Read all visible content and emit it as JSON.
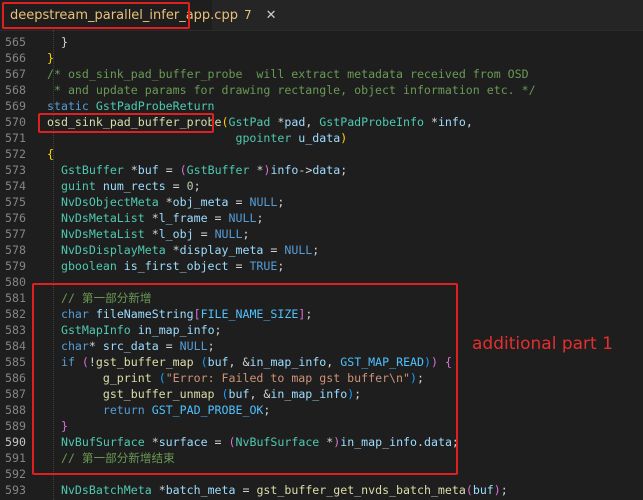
{
  "tab": {
    "filename": "deepstream_parallel_infer_app.cpp",
    "problem_count": "7",
    "close_glyph": "✕"
  },
  "annotation": "additional part 1",
  "line_numbers": [
    "565",
    "566",
    "567",
    "568",
    "569",
    "570",
    "571",
    "572",
    "573",
    "574",
    "575",
    "576",
    "577",
    "578",
    "579",
    "580",
    "581",
    "582",
    "583",
    "584",
    "585",
    "586",
    "587",
    "588",
    "589",
    "590",
    "591",
    "592",
    "593"
  ],
  "lines": [
    [
      [
        "p",
        "  }"
      ]
    ],
    [
      [
        "b1",
        "}"
      ]
    ],
    [
      [
        "c",
        "/* osd_sink_pad_buffer_probe  will extract metadata received from OSD"
      ]
    ],
    [
      [
        "c",
        " * and update params for drawing rectangle, object information etc. */"
      ]
    ],
    [
      [
        "k",
        "static "
      ],
      [
        "t",
        "GstPadProbeReturn"
      ]
    ],
    [
      [
        "f",
        "osd_sink_pad_buffer_probe"
      ],
      [
        "b1",
        "("
      ],
      [
        "t",
        "GstPad"
      ],
      [
        "p",
        " *"
      ],
      [
        "v",
        "pad"
      ],
      [
        "p",
        ", "
      ],
      [
        "t",
        "GstPadProbeInfo"
      ],
      [
        "p",
        " *"
      ],
      [
        "v",
        "info"
      ],
      [
        "p",
        ","
      ]
    ],
    [
      [
        "p",
        "                           "
      ],
      [
        "t",
        "gpointer"
      ],
      [
        "p",
        " "
      ],
      [
        "v",
        "u_data"
      ],
      [
        "b1",
        ")"
      ]
    ],
    [
      [
        "b1",
        "{"
      ]
    ],
    [
      [
        "p",
        "  "
      ],
      [
        "t",
        "GstBuffer"
      ],
      [
        "p",
        " *"
      ],
      [
        "v",
        "buf"
      ],
      [
        "p",
        " = "
      ],
      [
        "b2",
        "("
      ],
      [
        "t",
        "GstBuffer"
      ],
      [
        "p",
        " *"
      ],
      [
        "b2",
        ")"
      ],
      [
        "v",
        "info"
      ],
      [
        "p",
        "->"
      ],
      [
        "v",
        "data"
      ],
      [
        "p",
        ";"
      ]
    ],
    [
      [
        "p",
        "  "
      ],
      [
        "t",
        "guint"
      ],
      [
        "p",
        " "
      ],
      [
        "v",
        "num_rects"
      ],
      [
        "p",
        " = "
      ],
      [
        "n",
        "0"
      ],
      [
        "p",
        ";"
      ]
    ],
    [
      [
        "p",
        "  "
      ],
      [
        "t",
        "NvDsObjectMeta"
      ],
      [
        "p",
        " *"
      ],
      [
        "v",
        "obj_meta"
      ],
      [
        "p",
        " = "
      ],
      [
        "k",
        "NULL"
      ],
      [
        "p",
        ";"
      ]
    ],
    [
      [
        "p",
        "  "
      ],
      [
        "t",
        "NvDsMetaList"
      ],
      [
        "p",
        " *"
      ],
      [
        "v",
        "l_frame"
      ],
      [
        "p",
        " = "
      ],
      [
        "k",
        "NULL"
      ],
      [
        "p",
        ";"
      ]
    ],
    [
      [
        "p",
        "  "
      ],
      [
        "t",
        "NvDsMetaList"
      ],
      [
        "p",
        " *"
      ],
      [
        "v",
        "l_obj"
      ],
      [
        "p",
        " = "
      ],
      [
        "k",
        "NULL"
      ],
      [
        "p",
        ";"
      ]
    ],
    [
      [
        "p",
        "  "
      ],
      [
        "t",
        "NvDsDisplayMeta"
      ],
      [
        "p",
        " *"
      ],
      [
        "v",
        "display_meta"
      ],
      [
        "p",
        " = "
      ],
      [
        "k",
        "NULL"
      ],
      [
        "p",
        ";"
      ]
    ],
    [
      [
        "p",
        "  "
      ],
      [
        "t",
        "gboolean"
      ],
      [
        "p",
        " "
      ],
      [
        "v",
        "is_first_object"
      ],
      [
        "p",
        " = "
      ],
      [
        "k",
        "TRUE"
      ],
      [
        "p",
        ";"
      ]
    ],
    [],
    [
      [
        "p",
        "  "
      ],
      [
        "c",
        "// 第一部分新增"
      ]
    ],
    [
      [
        "p",
        "  "
      ],
      [
        "k",
        "char"
      ],
      [
        "p",
        " "
      ],
      [
        "v",
        "fileNameString"
      ],
      [
        "b2",
        "["
      ],
      [
        "m",
        "FILE_NAME_SIZE"
      ],
      [
        "b2",
        "]"
      ],
      [
        "p",
        ";"
      ]
    ],
    [
      [
        "p",
        "  "
      ],
      [
        "t",
        "GstMapInfo"
      ],
      [
        "p",
        " "
      ],
      [
        "v",
        "in_map_info"
      ],
      [
        "p",
        ";"
      ]
    ],
    [
      [
        "p",
        "  "
      ],
      [
        "k",
        "char"
      ],
      [
        "p",
        "* "
      ],
      [
        "v",
        "src_data"
      ],
      [
        "p",
        " = "
      ],
      [
        "k",
        "NULL"
      ],
      [
        "p",
        ";"
      ]
    ],
    [
      [
        "p",
        "  "
      ],
      [
        "k",
        "if"
      ],
      [
        "p",
        " "
      ],
      [
        "b2",
        "("
      ],
      [
        "p",
        "!"
      ],
      [
        "f",
        "gst_buffer_map"
      ],
      [
        "p",
        " "
      ],
      [
        "b3",
        "("
      ],
      [
        "v",
        "buf"
      ],
      [
        "p",
        ", &"
      ],
      [
        "v",
        "in_map_info"
      ],
      [
        "p",
        ", "
      ],
      [
        "m",
        "GST_MAP_READ"
      ],
      [
        "b3",
        ")"
      ],
      [
        "b2",
        ")"
      ],
      [
        "p",
        " "
      ],
      [
        "b2",
        "{"
      ]
    ],
    [
      [
        "p",
        "        "
      ],
      [
        "f",
        "g_print"
      ],
      [
        "p",
        " "
      ],
      [
        "b3",
        "("
      ],
      [
        "s",
        "\"Error: Failed to map gst buffer\\n\""
      ],
      [
        "b3",
        ")"
      ],
      [
        "p",
        ";"
      ]
    ],
    [
      [
        "p",
        "        "
      ],
      [
        "f",
        "gst_buffer_unmap"
      ],
      [
        "p",
        " "
      ],
      [
        "b3",
        "("
      ],
      [
        "v",
        "buf"
      ],
      [
        "p",
        ", &"
      ],
      [
        "v",
        "in_map_info"
      ],
      [
        "b3",
        ")"
      ],
      [
        "p",
        ";"
      ]
    ],
    [
      [
        "p",
        "        "
      ],
      [
        "k",
        "return"
      ],
      [
        "p",
        " "
      ],
      [
        "m",
        "GST_PAD_PROBE_OK"
      ],
      [
        "p",
        ";"
      ]
    ],
    [
      [
        "p",
        "  "
      ],
      [
        "b2",
        "}"
      ]
    ],
    [
      [
        "p",
        "  "
      ],
      [
        "t",
        "NvBufSurface"
      ],
      [
        "p",
        " *"
      ],
      [
        "v",
        "surface"
      ],
      [
        "p",
        " = "
      ],
      [
        "b2",
        "("
      ],
      [
        "t",
        "NvBufSurface"
      ],
      [
        "p",
        " *"
      ],
      [
        "b2",
        ")"
      ],
      [
        "v",
        "in_map_info"
      ],
      [
        "p",
        "."
      ],
      [
        "v",
        "data"
      ],
      [
        "p",
        ";"
      ]
    ],
    [
      [
        "p",
        "  "
      ],
      [
        "c",
        "// 第一部分新增结束"
      ]
    ],
    [],
    [
      [
        "p",
        "  "
      ],
      [
        "t",
        "NvDsBatchMeta"
      ],
      [
        "p",
        " *"
      ],
      [
        "v",
        "batch_meta"
      ],
      [
        "p",
        " = "
      ],
      [
        "f",
        "gst_buffer_get_nvds_batch_meta"
      ],
      [
        "b2",
        "("
      ],
      [
        "v",
        "buf"
      ],
      [
        "b2",
        ")"
      ],
      [
        "p",
        ";"
      ]
    ]
  ]
}
